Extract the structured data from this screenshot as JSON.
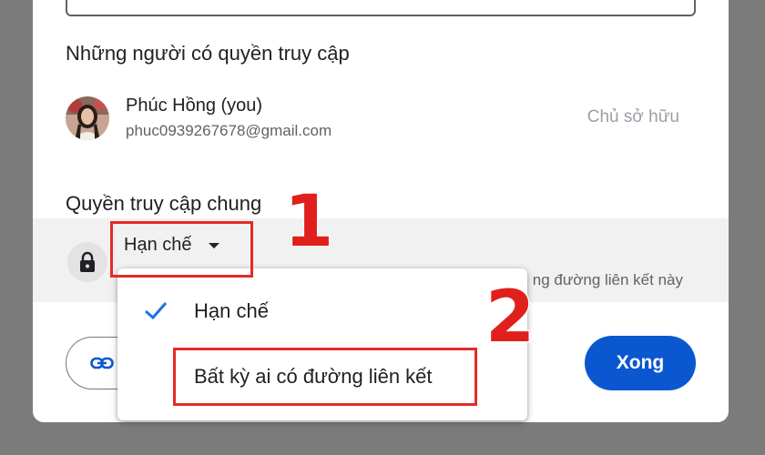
{
  "dialog": {
    "people_section_title": "Những người có quyền truy cập",
    "owner": {
      "name": "Phúc Hồng (you)",
      "email": "phuc0939267678@gmail.com",
      "role": "Chủ sở hữu"
    },
    "general_access_title": "Quyền truy cập chung",
    "general_access": {
      "selected": "Hạn chế",
      "description": "ng đường liên kết này"
    },
    "copy_link_icon": "link-icon",
    "done_label": "Xong"
  },
  "menu": {
    "items": [
      {
        "label": "Hạn chế",
        "checked": true
      },
      {
        "label": "Bất kỳ ai có đường liên kết",
        "checked": false
      }
    ]
  },
  "annotations": {
    "step1": "1",
    "step2": "2",
    "highlight_color": "#e52a24"
  },
  "colors": {
    "primary": "#0b57d0",
    "overlay": "#7b7b7b"
  }
}
